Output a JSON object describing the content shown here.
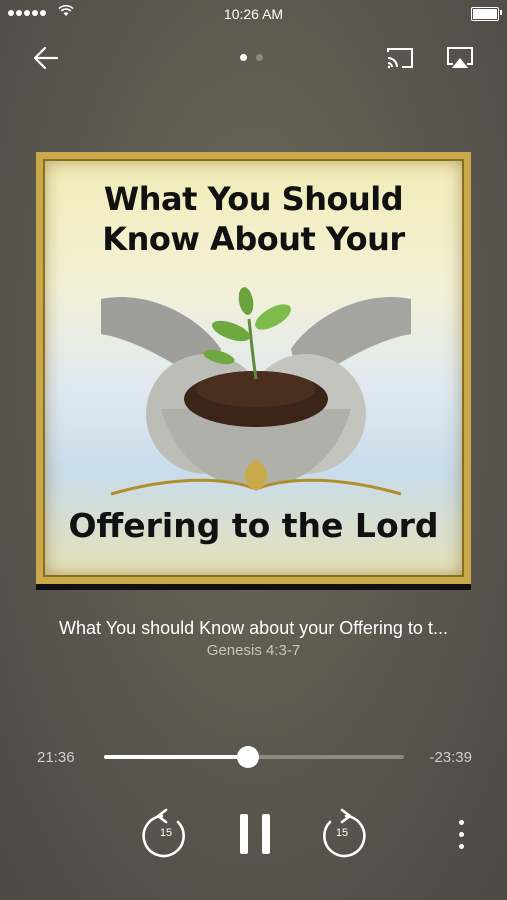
{
  "status_bar": {
    "time": "10:26 AM",
    "signal_icon": "cellular-signal-icon",
    "wifi_icon": "wifi-icon",
    "battery_icon": "battery-icon"
  },
  "topbar": {
    "back_icon": "arrow-left-icon",
    "page_indicator": {
      "count": 2,
      "active_index": 0
    },
    "cast_icon": "cast-icon",
    "airplay_icon": "airplay-icon"
  },
  "artwork": {
    "title_line1": "What You Should",
    "title_line2": "Know About Your",
    "title_bottom": "Offering to the Lord",
    "illustration": "cupped-hands-holding-soil-with-sprout"
  },
  "track": {
    "title": "What You should Know about your Offering to t...",
    "subtitle": "Genesis 4:3-7"
  },
  "playback": {
    "elapsed": "21:36",
    "remaining": "-23:39",
    "progress_fraction": 0.48
  },
  "controls": {
    "rewind_label": "15",
    "forward_label": "15",
    "rewind_icon": "rewind-15-icon",
    "pause_icon": "pause-icon",
    "forward_icon": "forward-15-icon",
    "more_icon": "more-vertical-icon"
  },
  "colors": {
    "background": "#5d5a50",
    "artwork_border": "#c9a94a",
    "progress_track": "#8d8a80",
    "accent": "#ffffff"
  }
}
